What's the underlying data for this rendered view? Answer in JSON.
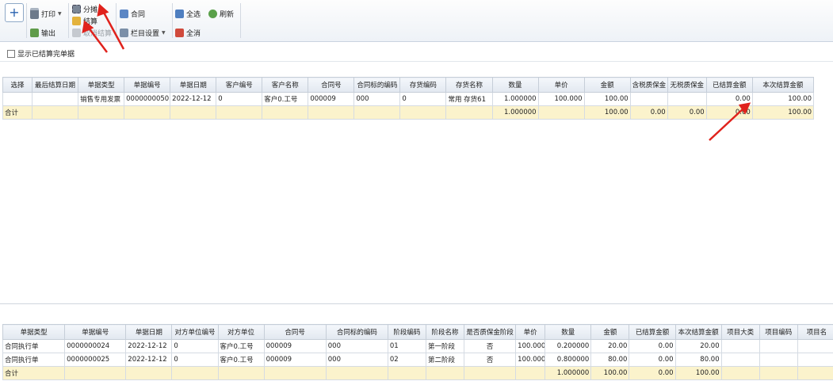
{
  "toolbar": {
    "new_symbol": "+",
    "print": "打印",
    "export": "输出",
    "apportion": "分摊",
    "settle": "结算",
    "cancel_settle": "取消结算",
    "contract": "合同",
    "column_settings": "栏目设置",
    "select_all": "全选",
    "deselect_all": "全消",
    "refresh": "刷新"
  },
  "options": {
    "show_settled": "显示已结算完单据"
  },
  "top_grid": {
    "columns": [
      "选择",
      "最后结算日期",
      "单据类型",
      "单据编号",
      "单据日期",
      "客户编号",
      "客户名称",
      "合同号",
      "合同标的编码",
      "存货编码",
      "存货名称",
      "数量",
      "单价",
      "金额",
      "含税质保金",
      "无税质保金",
      "已结算金额",
      "本次结算金额"
    ],
    "rows": [
      [
        "",
        "",
        "销售专用发票",
        "0000000050",
        "2022-12-12",
        "0",
        "客户0.工号",
        "000009",
        "000",
        "0",
        "常用 存货61",
        "1.000000",
        "100.000",
        "100.00",
        "",
        "",
        "0.00",
        "100.00"
      ]
    ],
    "total": [
      "合计",
      "",
      "",
      "",
      "",
      "",
      "",
      "",
      "",
      "",
      "",
      "1.000000",
      "",
      "100.00",
      "0.00",
      "0.00",
      "0.00",
      "100.00"
    ]
  },
  "bottom_grid": {
    "columns": [
      "单据类型",
      "单据编号",
      "单据日期",
      "对方单位编号",
      "对方单位",
      "合同号",
      "合同标的编码",
      "阶段编码",
      "阶段名称",
      "是否质保金阶段",
      "单价",
      "数量",
      "金额",
      "已结算金额",
      "本次结算金额",
      "项目大类",
      "项目编码",
      "项目名"
    ],
    "rows": [
      [
        "合同执行单",
        "0000000024",
        "2022-12-12",
        "0",
        "客户0.工号",
        "000009",
        "000",
        "01",
        "第一阶段",
        "否",
        "100.000",
        "0.200000",
        "20.00",
        "0.00",
        "20.00",
        "",
        "",
        ""
      ],
      [
        "合同执行单",
        "0000000025",
        "2022-12-12",
        "0",
        "客户0.工号",
        "000009",
        "000",
        "02",
        "第二阶段",
        "否",
        "100.000",
        "0.800000",
        "80.00",
        "0.00",
        "80.00",
        "",
        "",
        ""
      ]
    ],
    "total": [
      "合计",
      "",
      "",
      "",
      "",
      "",
      "",
      "",
      "",
      "",
      "",
      "1.000000",
      "100.00",
      "0.00",
      "100.00",
      "",
      "",
      ""
    ]
  },
  "colors": {
    "arrow": "#e0221c",
    "sum_row": "#fbf3cc",
    "header": "#e2e8f0"
  }
}
